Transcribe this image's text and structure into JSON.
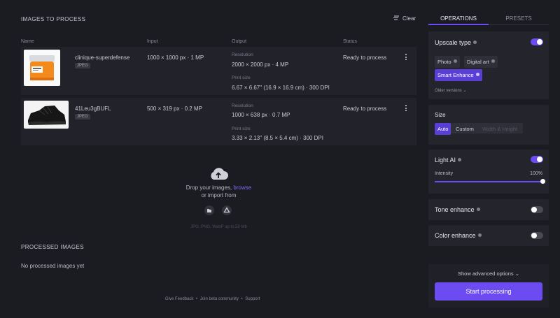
{
  "queue": {
    "title": "IMAGES TO PROCESS",
    "clear_label": "Clear",
    "columns": [
      "Name",
      "Input",
      "Output",
      "Status"
    ],
    "rows": [
      {
        "name": "clinique-superdefense",
        "format": "JPEG",
        "input": "1000 × 1000 px · 1 MP",
        "resolution_label": "Resolution",
        "resolution": "2000 × 2000 px · 4 MP",
        "print_label": "Print size",
        "print": "6.67 × 6.67\" (16.9 × 16.9 cm) · 300 DPI",
        "status": "Ready to process"
      },
      {
        "name": "41Leu3gBUFL",
        "format": "JPEG",
        "input": "500 × 319 px · 0.2 MP",
        "resolution_label": "Resolution",
        "resolution": "1000 × 638 px · 0.7 MP",
        "print_label": "Print size",
        "print": "3.33 × 2.13\" (8.5 × 5.4 cm) · 300 DPI",
        "status": "Ready to process"
      }
    ]
  },
  "dropzone": {
    "text_prefix": "Drop your images, ",
    "browse": "browse",
    "import_text": "or import from",
    "formats": "JPG, PNG, WebP up to 50 Mb"
  },
  "processed": {
    "title": "PROCESSED IMAGES",
    "empty": "No processed images yet"
  },
  "footer": {
    "feedback": "Give Feedback",
    "community": "Join beta community",
    "support": "Support",
    "sep": "•"
  },
  "sidebar": {
    "tabs": [
      "OPERATIONS",
      "PRESETS"
    ],
    "upscale": {
      "title": "Upscale type",
      "enabled": true,
      "options": [
        "Photo",
        "Digital art",
        "Smart Enhance"
      ],
      "selected": "Smart Enhance",
      "older": "Older versions"
    },
    "size": {
      "title": "Size",
      "options": [
        "Auto",
        "Custom",
        "Width & Height"
      ],
      "selected": "Auto"
    },
    "light_ai": {
      "title": "Light AI",
      "enabled": true,
      "intensity_label": "Intensity",
      "intensity_value": "100%",
      "intensity": 1.0
    },
    "tone": {
      "title": "Tone enhance",
      "enabled": false
    },
    "color": {
      "title": "Color enhance",
      "enabled": false
    },
    "advanced": "Show advanced options",
    "start": "Start processing"
  },
  "colors": {
    "accent": "#6c4bf0",
    "background": "#1b1b22",
    "link": "#7b6cf6"
  }
}
